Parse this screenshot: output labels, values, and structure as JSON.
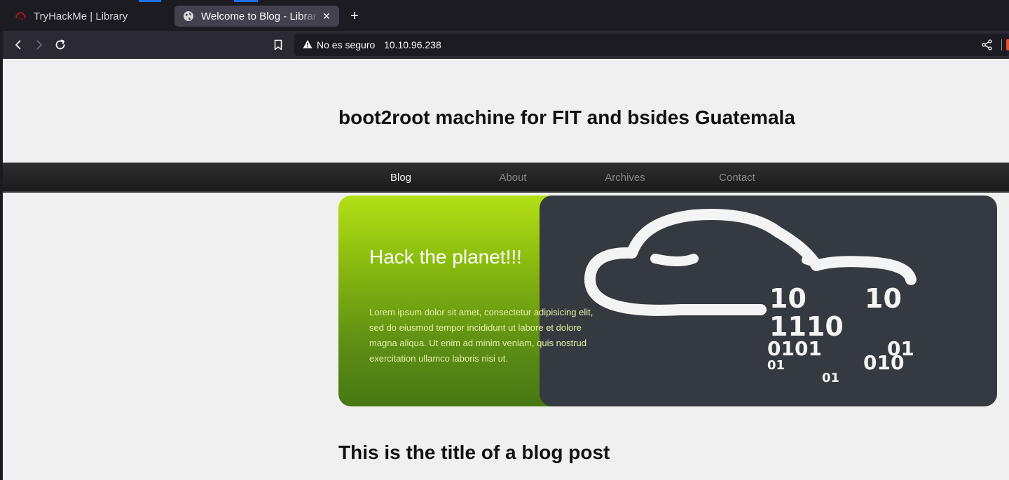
{
  "browser": {
    "tabs": [
      {
        "title": "TryHackMe | Library",
        "icon": "tryhackme-icon",
        "active": false
      },
      {
        "title": "Welcome to Blog - Library",
        "icon": "globe-icon",
        "active": true
      }
    ],
    "address_bar": {
      "security_label": "No es seguro",
      "url": "10.10.96.238"
    }
  },
  "site": {
    "title": "boot2root machine for FIT and bsides Guatemala",
    "menu": [
      "Blog",
      "About",
      "Archives",
      "Contact"
    ],
    "active_menu": "Blog",
    "hero": {
      "heading": "Hack the planet!!!",
      "text": "Lorem ipsum dolor sit amet, consectetur adipisicing elit, sed do eiusmod tempor incididunt ut labore et dolore magna aliqua. Ut enim ad minim veniam, quis nostrud exercitation ullamco laboris nisi ut.",
      "image_binary": [
        "10",
        "10",
        "1110",
        "0101",
        "01",
        "01",
        "010",
        "01"
      ]
    },
    "post_title": "This is the title of a blog post"
  }
}
